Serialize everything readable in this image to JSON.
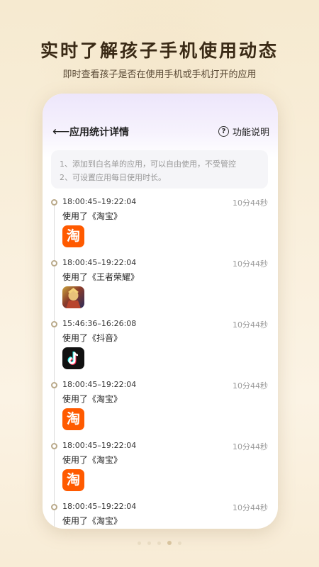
{
  "page": {
    "headline": "实时了解孩子手机使用动态",
    "subline": "即时查看孩子是否在使用手机或手机打开的应用"
  },
  "app": {
    "nav": {
      "back_icon": "back-arrow-icon",
      "title": "应用统计详情",
      "help_label": "功能说明",
      "help_icon": "question-circle-icon"
    },
    "notice": {
      "line1": "1、添加到白名单的应用，可以自由使用，不受管控",
      "line2": "2、可设置应用每日使用时长。"
    },
    "entries": [
      {
        "time": "18:00:45–19:22:04",
        "app": "使用了《淘宝》",
        "duration": "10分44秒",
        "icon": "taobao-icon",
        "icon_glyph": "淘"
      },
      {
        "time": "18:00:45–19:22:04",
        "app": "使用了《王者荣耀》",
        "duration": "10分44秒",
        "icon": "game-icon"
      },
      {
        "time": "15:46:36–16:26:08",
        "app": "使用了《抖音》",
        "duration": "10分44秒",
        "icon": "tiktok-icon"
      },
      {
        "time": "18:00:45–19:22:04",
        "app": "使用了《淘宝》",
        "duration": "10分44秒",
        "icon": "taobao-icon",
        "icon_glyph": "淘"
      },
      {
        "time": "18:00:45–19:22:04",
        "app": "使用了《淘宝》",
        "duration": "10分44秒",
        "icon": "taobao-icon",
        "icon_glyph": "淘"
      },
      {
        "time": "18:00:45–19:22:04",
        "app": "使用了《淘宝》",
        "duration": "10分44秒"
      }
    ]
  },
  "pager": {
    "count": 5,
    "active": 4
  },
  "colors": {
    "taobao": "#ff5a00",
    "accent": "#b9a98a"
  }
}
